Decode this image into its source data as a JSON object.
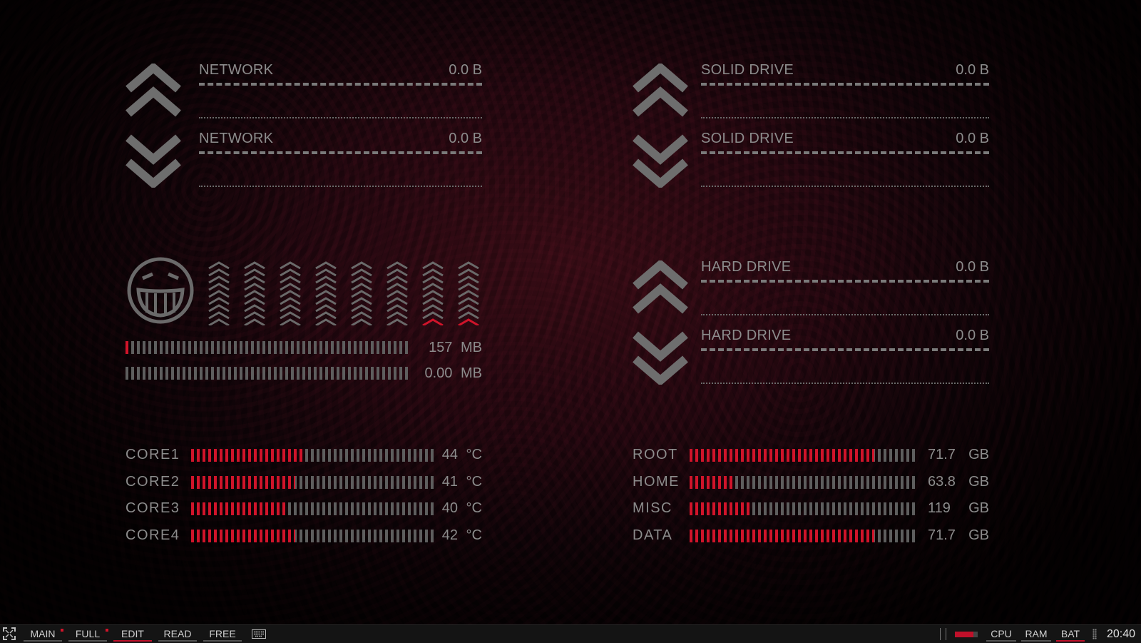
{
  "network": {
    "up": {
      "label": "NETWORK",
      "value": "0.0 B"
    },
    "down": {
      "label": "NETWORK",
      "value": "0.0 B"
    }
  },
  "solid_drive": {
    "read": {
      "label": "SOLID DRIVE",
      "value": "0.0 B"
    },
    "write": {
      "label": "SOLID DRIVE",
      "value": "0.0 B"
    }
  },
  "hard_drive": {
    "read": {
      "label": "HARD DRIVE",
      "value": "0.0 B"
    },
    "write": {
      "label": "HARD DRIVE",
      "value": "0.0 B"
    }
  },
  "memory": {
    "ram": {
      "value": "157",
      "unit": "MB",
      "fill": 0.02
    },
    "swap": {
      "value": "0.00",
      "unit": "MB",
      "fill": 0.0
    }
  },
  "cpu_cores_active": [
    false,
    false,
    false,
    false,
    false,
    false,
    true,
    true
  ],
  "cores": [
    {
      "label": "CORE1",
      "value": "44 °C",
      "fill": 0.46
    },
    {
      "label": "CORE2",
      "value": "41 °C",
      "fill": 0.43
    },
    {
      "label": "CORE3",
      "value": "40 °C",
      "fill": 0.4
    },
    {
      "label": "CORE4",
      "value": "42 °C",
      "fill": 0.43
    }
  ],
  "disks": [
    {
      "label": "ROOT",
      "value": "71.7",
      "unit": "GB",
      "fill": 0.81
    },
    {
      "label": "HOME",
      "value": "63.8",
      "unit": "GB",
      "fill": 0.19
    },
    {
      "label": "MISC",
      "value": "119",
      "unit": "GB",
      "fill": 0.27
    },
    {
      "label": "DATA",
      "value": "71.7",
      "unit": "GB",
      "fill": 0.81
    }
  ],
  "taskbar": {
    "fullscreen_icon": "fullscreen-icon",
    "tabs": [
      {
        "label": "MAIN",
        "active": false,
        "marked": true
      },
      {
        "label": "FULL",
        "active": false,
        "marked": true
      },
      {
        "label": "EDIT",
        "active": true,
        "marked": false
      },
      {
        "label": "READ",
        "active": false,
        "marked": false
      },
      {
        "label": "FREE",
        "active": false,
        "marked": false
      }
    ],
    "keyboard_icon": "keyboard-icon",
    "monitors": [
      "CPU",
      "RAM",
      "BAT"
    ],
    "clock": "20:40"
  },
  "colors": {
    "accent": "#d0142a",
    "text": "#8c8c8c",
    "inactive_bar": "#5e5e5e"
  }
}
